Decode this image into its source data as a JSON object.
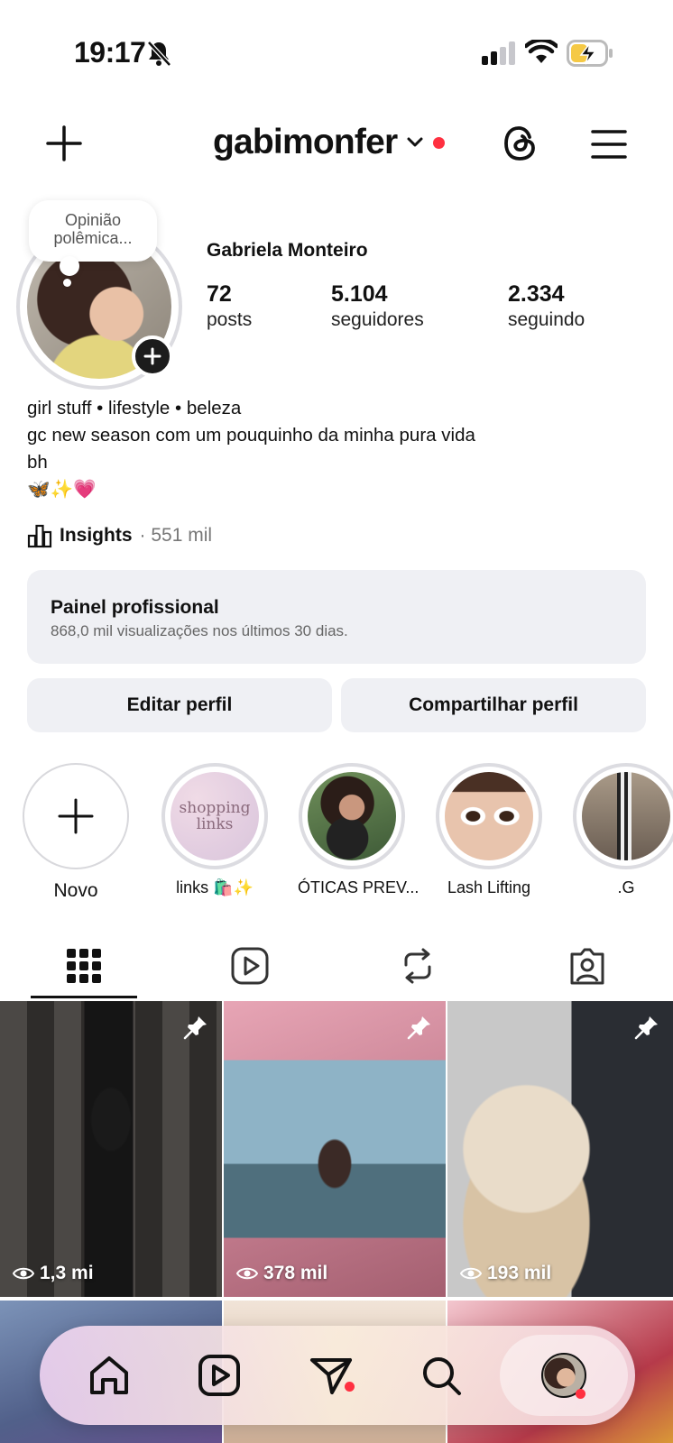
{
  "status_bar": {
    "time": "19:17"
  },
  "header": {
    "username": "gabimonfer"
  },
  "profile": {
    "note": "Opinião polêmica...",
    "full_name": "Gabriela Monteiro",
    "stats": [
      {
        "value": "72",
        "label": "posts"
      },
      {
        "value": "5.104",
        "label": "seguidores"
      },
      {
        "value": "2.334",
        "label": "seguindo"
      }
    ],
    "bio_lines": [
      "girl stuff • lifestyle • beleza",
      "gc new season com um pouquinho da minha pura vida",
      "bh",
      "🦋✨💗"
    ]
  },
  "insights": {
    "label": "Insights",
    "value": "· 551 mil"
  },
  "panel": {
    "title": "Painel profissional",
    "subtitle": "868,0 mil visualizações nos últimos 30 dias."
  },
  "buttons": {
    "edit": "Editar perfil",
    "share": "Compartilhar perfil"
  },
  "highlights": [
    {
      "label": "Novo",
      "image_text": ""
    },
    {
      "label": "links 🛍️✨",
      "image_text": "shopping links"
    },
    {
      "label": "ÓTICAS PREV...",
      "image_text": ""
    },
    {
      "label": "Lash Lifting",
      "image_text": ""
    },
    {
      "label": ".G",
      "image_text": ""
    }
  ],
  "posts": [
    {
      "views": "1,3 mi",
      "pinned": true
    },
    {
      "views": "378 mil",
      "pinned": true
    },
    {
      "views": "193 mil",
      "pinned": true
    }
  ],
  "colors": {
    "notification_red": "#ff3040",
    "panel_bg": "#eff0f4",
    "ring": "#dcdce1"
  }
}
